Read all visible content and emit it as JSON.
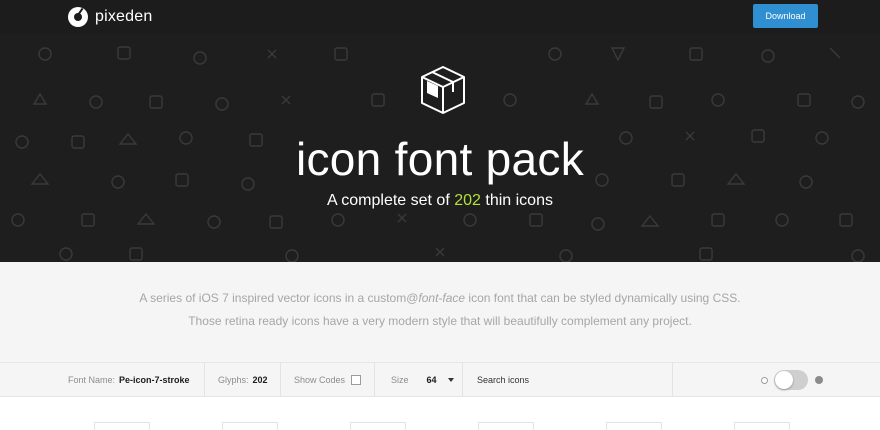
{
  "header": {
    "brand": "pixeden",
    "download_label": "Download"
  },
  "hero": {
    "title": "icon font pack",
    "subtitle_prefix": "A complete set of ",
    "subtitle_count": "202",
    "subtitle_suffix": " thin icons"
  },
  "description": {
    "line1_pre": "A series of iOS 7 inspired vector icons in a custom@",
    "line1_em": "font-face",
    "line1_post": " icon font that can be styled dynamically using CSS.",
    "line2": "Those retina ready icons have a very modern style that will beautifully complement any project."
  },
  "toolbar": {
    "font_name_label": "Font Name:",
    "font_name_value": "Pe-icon-7-stroke",
    "glyphs_label": "Glyphs:",
    "glyphs_value": "202",
    "show_codes_label": "Show Codes",
    "size_label": "Size",
    "size_value": "64",
    "search_placeholder": "Search icons"
  },
  "colors": {
    "accent_green": "#b6e03a",
    "download_blue": "#2f8fd0",
    "dark_bg": "#1e1e1e"
  },
  "icons": {
    "brand_logo": "pixeden-logo-icon",
    "hero_icon": "package-box-icon"
  }
}
